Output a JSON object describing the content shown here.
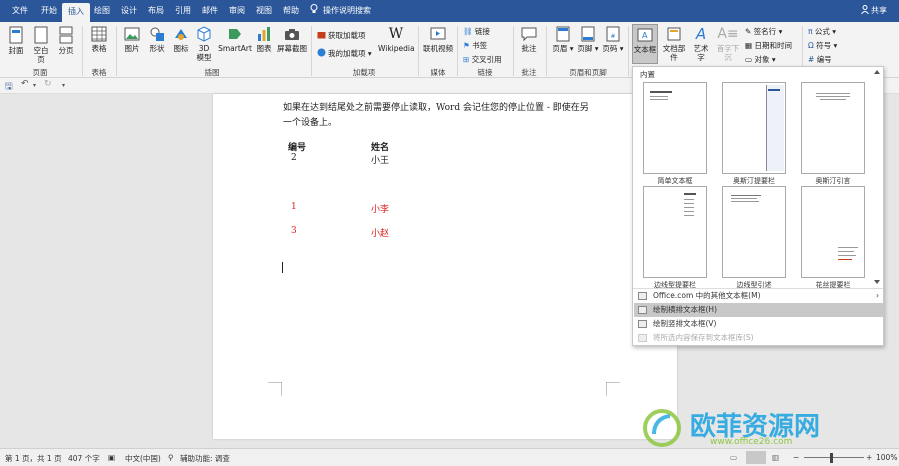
{
  "menubar": {
    "tabs": [
      "文件",
      "开始",
      "插入",
      "绘图",
      "设计",
      "布局",
      "引用",
      "邮件",
      "审阅",
      "视图",
      "帮助"
    ],
    "active_tab": "插入",
    "tell_me": "操作说明搜索",
    "share": "共享"
  },
  "ribbon": {
    "pages": {
      "cover": "封面",
      "blank": "空白页",
      "break": "分页",
      "group": "页面"
    },
    "tables": {
      "table": "表格",
      "group": "表格"
    },
    "illustrations": {
      "pictures": "图片",
      "shapes": "形状",
      "icons": "图标",
      "models": "3D 模型",
      "smartart": "SmartArt",
      "chart": "图表",
      "screenshot": "屏幕截图",
      "group": "插图"
    },
    "addins": {
      "get": "获取加载项",
      "my": "我的加载项",
      "wikipedia": "Wikipedia",
      "group": "加载项"
    },
    "media": {
      "video": "联机视频",
      "group": "媒体"
    },
    "links": {
      "link": "链接",
      "bookmark": "书签",
      "crossref": "交叉引用",
      "group": "链接"
    },
    "comments": {
      "comment": "批注",
      "group": "批注"
    },
    "header_footer": {
      "header": "页眉",
      "footer": "页脚",
      "pagenum": "页码",
      "group": "页眉和页脚"
    },
    "text": {
      "textbox": "文本框",
      "quickparts": "文档部件",
      "wordart": "艺术字",
      "dropcap": "首字下沉",
      "signature": "签名行",
      "datetime": "日期和时间",
      "object": "对象"
    },
    "symbols": {
      "equation": "公式",
      "symbol": "符号",
      "number": "编号"
    }
  },
  "document": {
    "para1": "如果在达到结尾处之前需要停止读取，Word 会记住您的停止位置 - 即使在另",
    "para2": "一个设备上。",
    "headers": [
      "编号",
      "姓名"
    ],
    "rows": [
      {
        "id": "2",
        "name": "小王",
        "color": "#222222"
      },
      {
        "id": "1",
        "name": "小李",
        "color": "#e02020"
      },
      {
        "id": "3",
        "name": "小赵",
        "color": "#e02020"
      }
    ]
  },
  "dropdown": {
    "section_title": "内置",
    "thumbnails": [
      "简单文本框",
      "奥斯汀提要栏",
      "奥斯汀引言",
      "边线型提要栏",
      "边线型引述",
      "花丝提要栏"
    ],
    "menu": [
      {
        "label": "Office.com 中的其他文本框(M)",
        "state": "normal"
      },
      {
        "label": "绘制横排文本框(H)",
        "state": "highlight"
      },
      {
        "label": "绘制竖排文本框(V)",
        "state": "normal"
      },
      {
        "label": "将所选内容保存到文本框库(S)",
        "state": "disabled"
      }
    ]
  },
  "status": {
    "page": "第 1 页，共 1 页",
    "words": "407 个字",
    "lang": "中文(中国)",
    "accessibility": "辅助功能: 调查",
    "zoom": "100%"
  },
  "watermark": {
    "text": "欧菲资源网",
    "url": "www.office26.com"
  }
}
